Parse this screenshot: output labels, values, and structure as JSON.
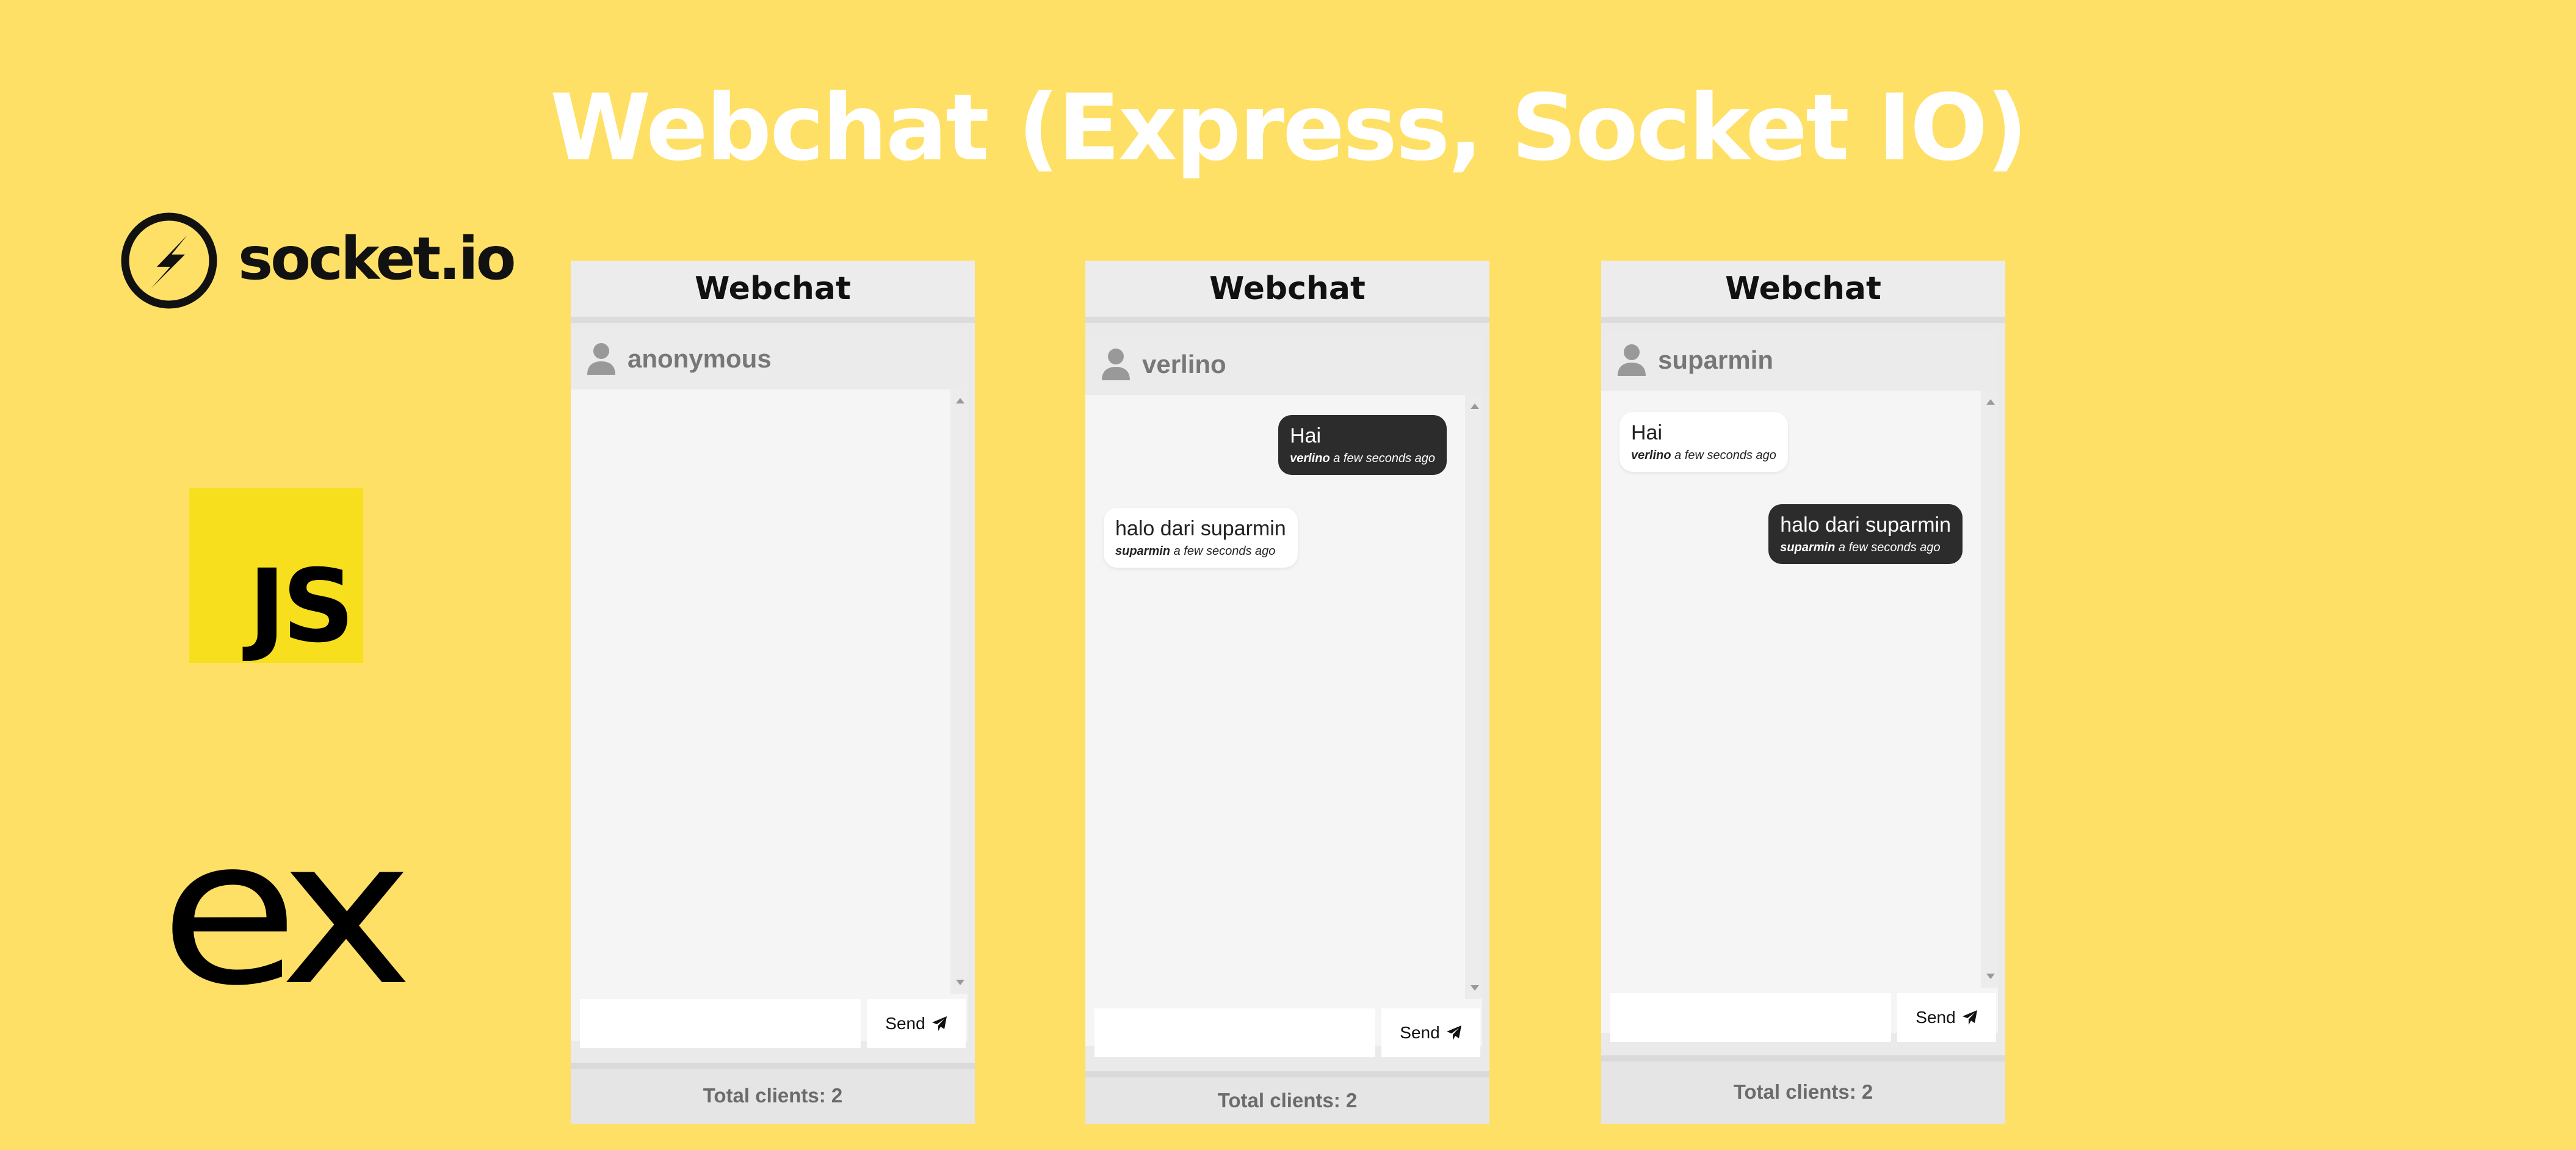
{
  "page": {
    "title": "Webchat (Express, Socket IO)",
    "background": "#ffe066"
  },
  "logos": {
    "socketio": {
      "label": "socket.io",
      "icon": "socket-io-logo"
    },
    "javascript": {
      "label": "JS",
      "icon": "javascript-logo",
      "color": "#f7df1e"
    },
    "express": {
      "label": "ex",
      "icon": "express-logo"
    }
  },
  "windows": [
    {
      "header": "Webchat",
      "username": "anonymous",
      "messages": [],
      "input": {
        "value": "",
        "placeholder": ""
      },
      "send_label": "Send",
      "footer": "Total clients: 2"
    },
    {
      "header": "Webchat",
      "username": "verlino",
      "messages": [
        {
          "text": "Hai",
          "author": "verlino",
          "time": "a few seconds ago",
          "own": true
        },
        {
          "text": "halo dari suparmin",
          "author": "suparmin",
          "time": "a few seconds ago",
          "own": false
        }
      ],
      "input": {
        "value": "",
        "placeholder": ""
      },
      "send_label": "Send",
      "footer": "Total clients: 2"
    },
    {
      "header": "Webchat",
      "username": "suparmin",
      "messages": [
        {
          "text": "Hai",
          "author": "verlino",
          "time": "a few seconds ago",
          "own": false
        },
        {
          "text": "halo dari suparmin",
          "author": "suparmin",
          "time": "a few seconds ago",
          "own": true
        }
      ],
      "input": {
        "value": "",
        "placeholder": ""
      },
      "send_label": "Send",
      "footer": "Total clients: 2"
    }
  ],
  "colors": {
    "own_bubble": "#2c2c2c",
    "other_bubble": "#ffffff"
  }
}
